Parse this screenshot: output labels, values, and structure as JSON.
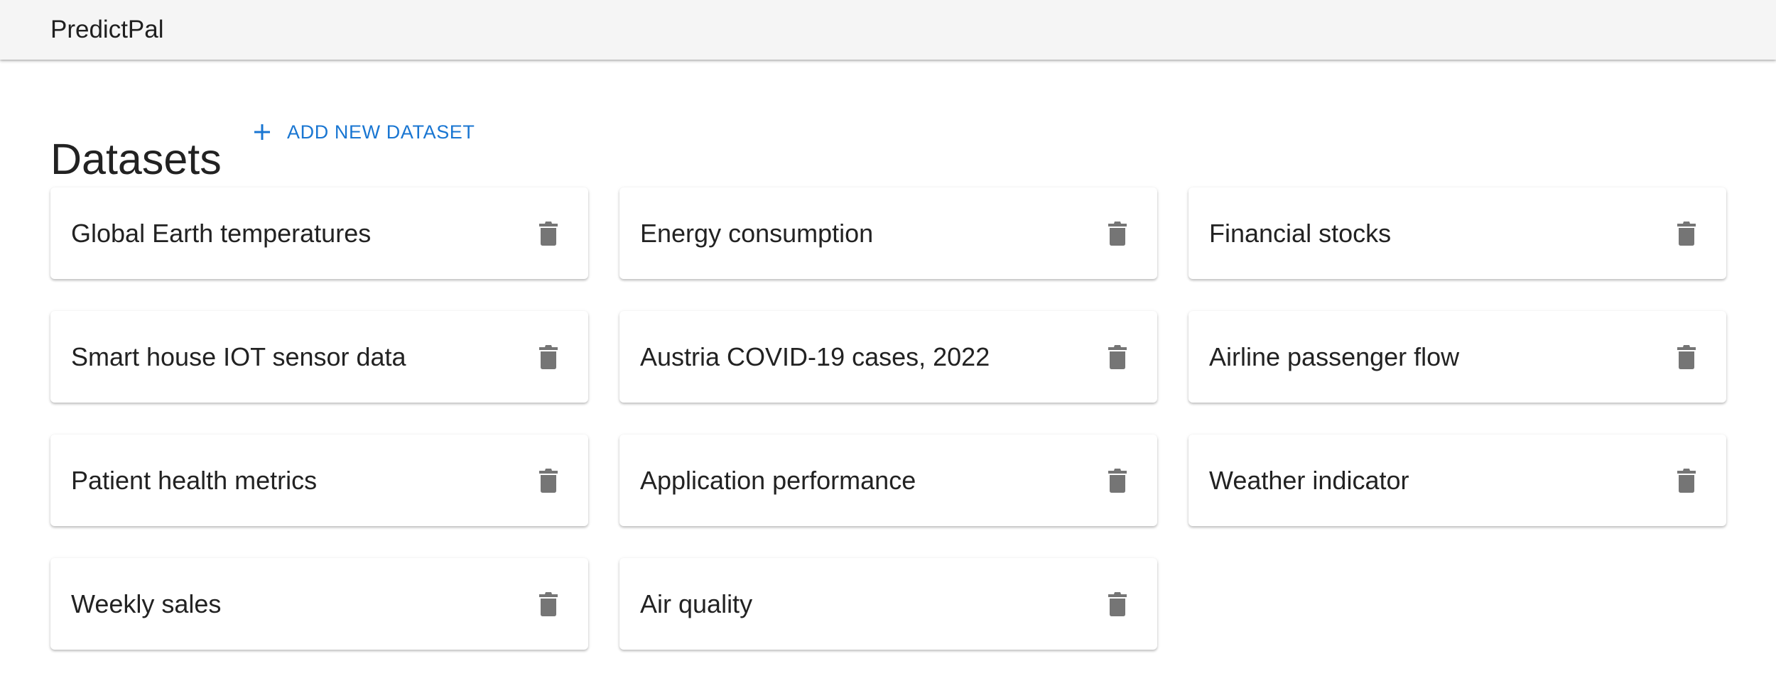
{
  "app": {
    "title": "PredictPal"
  },
  "page": {
    "title": "Datasets",
    "add_label": "ADD NEW DATASET"
  },
  "datasets": [
    {
      "name": "Global Earth temperatures"
    },
    {
      "name": "Energy consumption"
    },
    {
      "name": "Financial stocks"
    },
    {
      "name": "Smart house IOT sensor data"
    },
    {
      "name": "Austria COVID-19 cases, 2022"
    },
    {
      "name": "Airline passenger flow"
    },
    {
      "name": "Patient health metrics"
    },
    {
      "name": "Application performance"
    },
    {
      "name": "Weather indicator"
    },
    {
      "name": "Weekly sales"
    },
    {
      "name": "Air quality"
    }
  ],
  "colors": {
    "accent": "#1976d2",
    "appbar_bg": "#f5f5f5",
    "icon_gray": "#757575"
  },
  "icons": {
    "add": "plus-icon",
    "delete": "trash-icon"
  }
}
